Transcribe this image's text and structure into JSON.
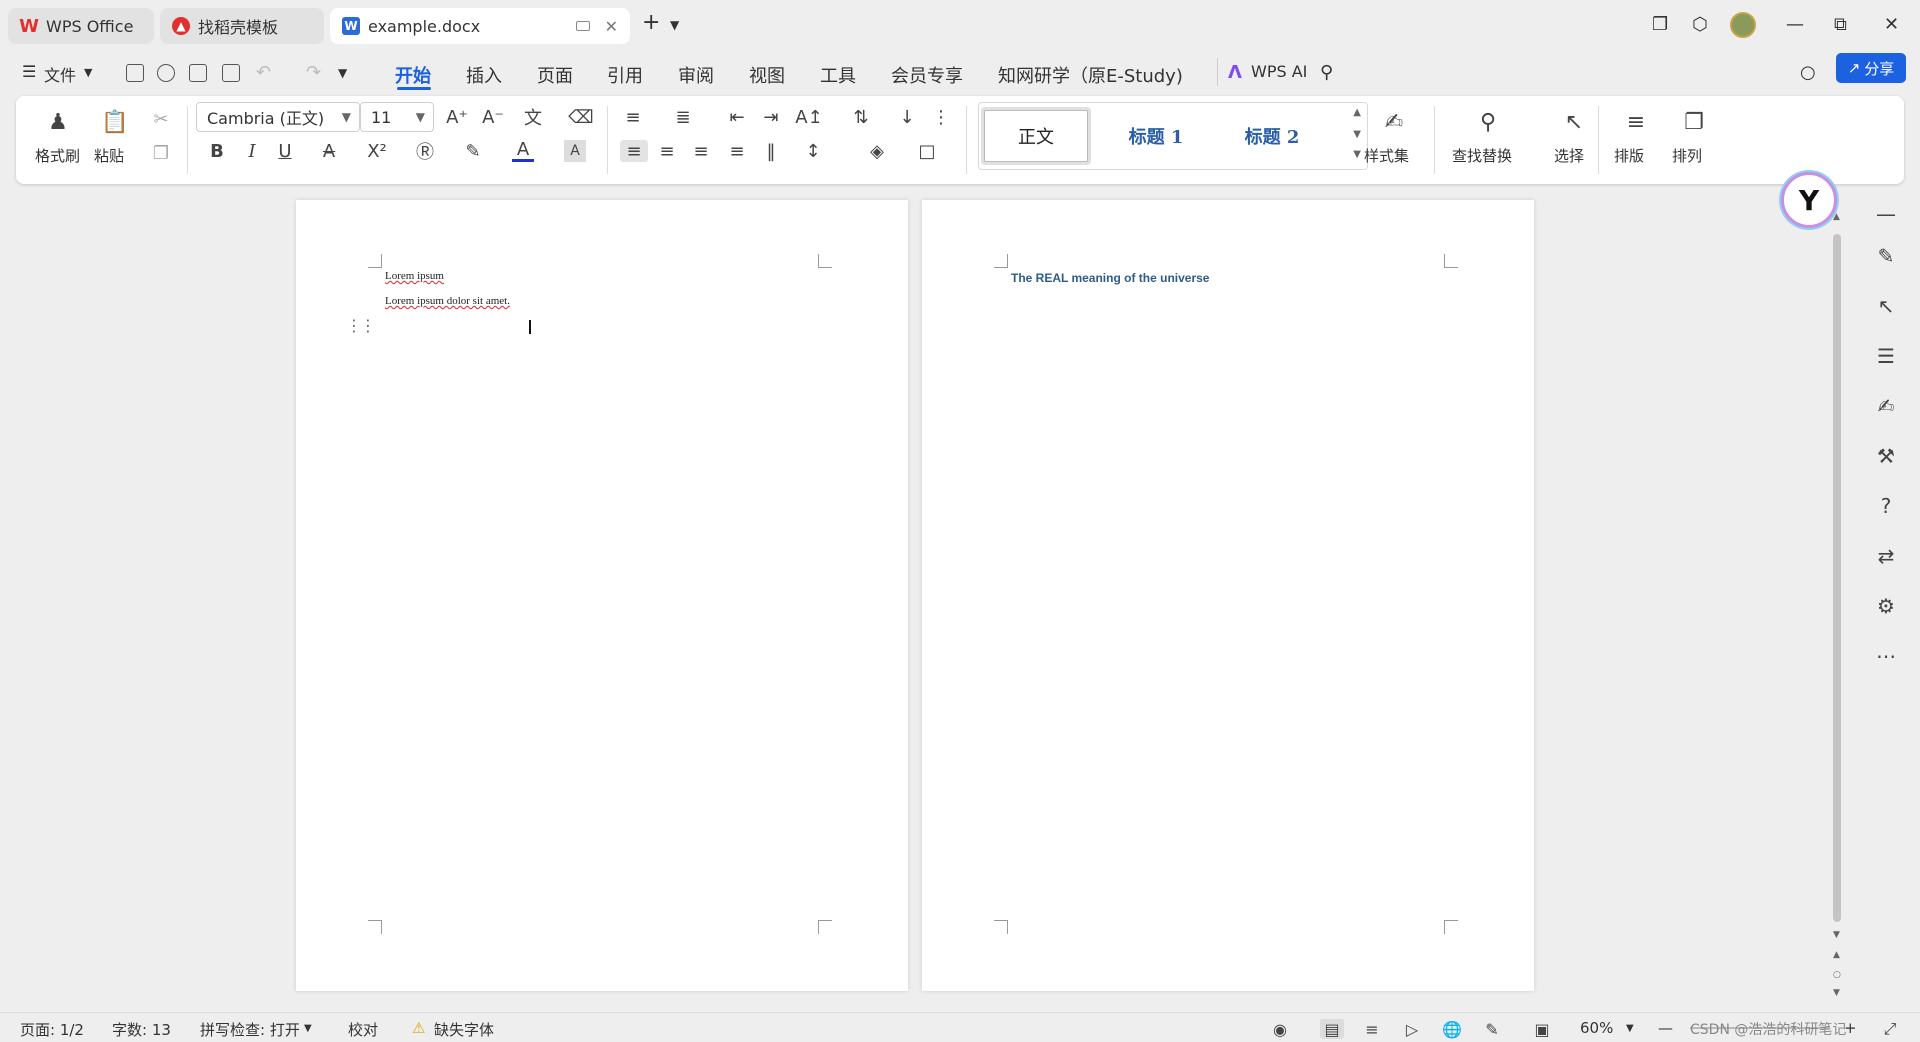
{
  "tabs": [
    {
      "label": "WPS Office",
      "icon": "wps-logo-icon"
    },
    {
      "label": "找稻壳模板",
      "icon": "docer-icon"
    },
    {
      "label": "example.docx",
      "icon": "word-doc-icon",
      "active": true
    }
  ],
  "menu": {
    "file_label": "文件",
    "items": [
      "开始",
      "插入",
      "页面",
      "引用",
      "审阅",
      "视图",
      "工具",
      "会员专享",
      "知网研学（原E-Study)"
    ],
    "active_index": 0,
    "wps_ai_label": "WPS AI",
    "share_label": "分享"
  },
  "ribbon": {
    "format_painter": "格式刷",
    "paste": "粘贴",
    "font_name": "Cambria (正文)",
    "font_size": "11",
    "styles": [
      "正文",
      "标题 1",
      "标题 2"
    ],
    "style_set": "样式集",
    "find_replace": "查找替换",
    "select": "选择",
    "layout": "排版",
    "arrange": "排列",
    "bold": "B",
    "italic": "I",
    "underline": "U",
    "font_color_letter": "A"
  },
  "document": {
    "page1_lines": [
      "Lorem ipsum",
      "Lorem ipsum dolor sit amet."
    ],
    "page2_heading": "The REAL meaning of the universe"
  },
  "status": {
    "page": "页面: 1/2",
    "word_count": "字数: 13",
    "spell_check": "拼写检查: 打开",
    "proofread": "校对",
    "missing_font": "缺失字体",
    "zoom": "60%",
    "watermark": "CSDN @浩浩的科研笔记"
  },
  "colors": {
    "accent": "#1b61e0",
    "heading_blue": "#2e5c8a",
    "wps_red": "#e0312e"
  }
}
